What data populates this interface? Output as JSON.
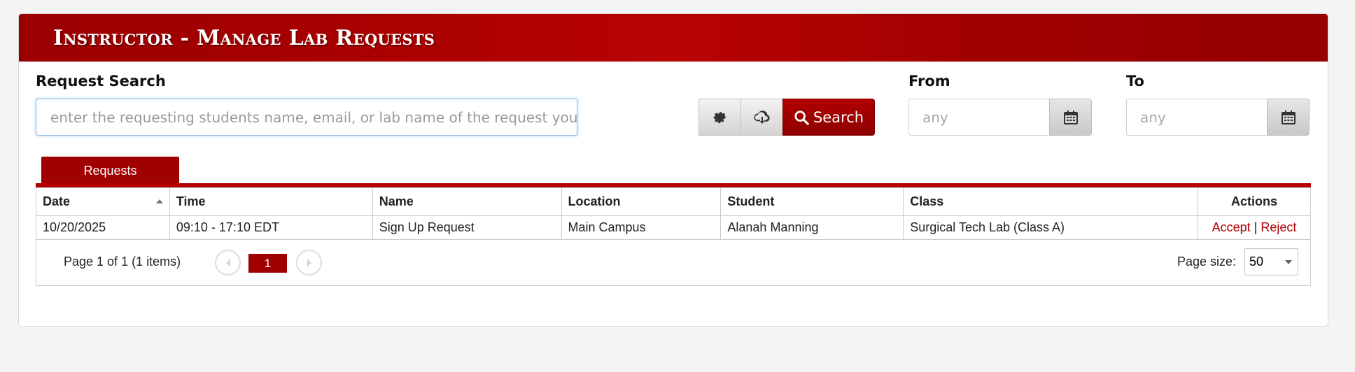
{
  "header": {
    "title": "Instructor - Manage Lab Requests"
  },
  "search": {
    "label": "Request Search",
    "value": "",
    "placeholder": "enter the requesting students name, email, or lab name of the request you want to search for",
    "button_label": "Search"
  },
  "from": {
    "label": "From",
    "placeholder": "any"
  },
  "to": {
    "label": "To",
    "placeholder": "any"
  },
  "tabs": [
    {
      "label": "Requests",
      "active": true
    }
  ],
  "table": {
    "columns": [
      "Date",
      "Time",
      "Name",
      "Location",
      "Student",
      "Class",
      "Actions"
    ],
    "rows": [
      {
        "date": "10/20/2025",
        "time": "09:10 - 17:10 EDT",
        "name": "Sign Up Request",
        "location": "Main Campus",
        "student": "Alanah Manning",
        "class": "Surgical Tech Lab (Class A)",
        "accept": "Accept",
        "separator": "|",
        "reject": "Reject"
      }
    ]
  },
  "pager": {
    "info": "Page 1 of 1 (1 items)",
    "current_page": "1",
    "page_size_label": "Page size:",
    "page_size": "50"
  },
  "colors": {
    "brand": "#a10000",
    "link": "#b30000",
    "focus": "#8fbde6"
  },
  "icons": [
    "gear-icon",
    "cloud-download-icon",
    "search-icon",
    "calendar-icon",
    "chevron-left-icon",
    "chevron-right-icon",
    "sort-ascending-icon",
    "chevron-down-icon"
  ]
}
